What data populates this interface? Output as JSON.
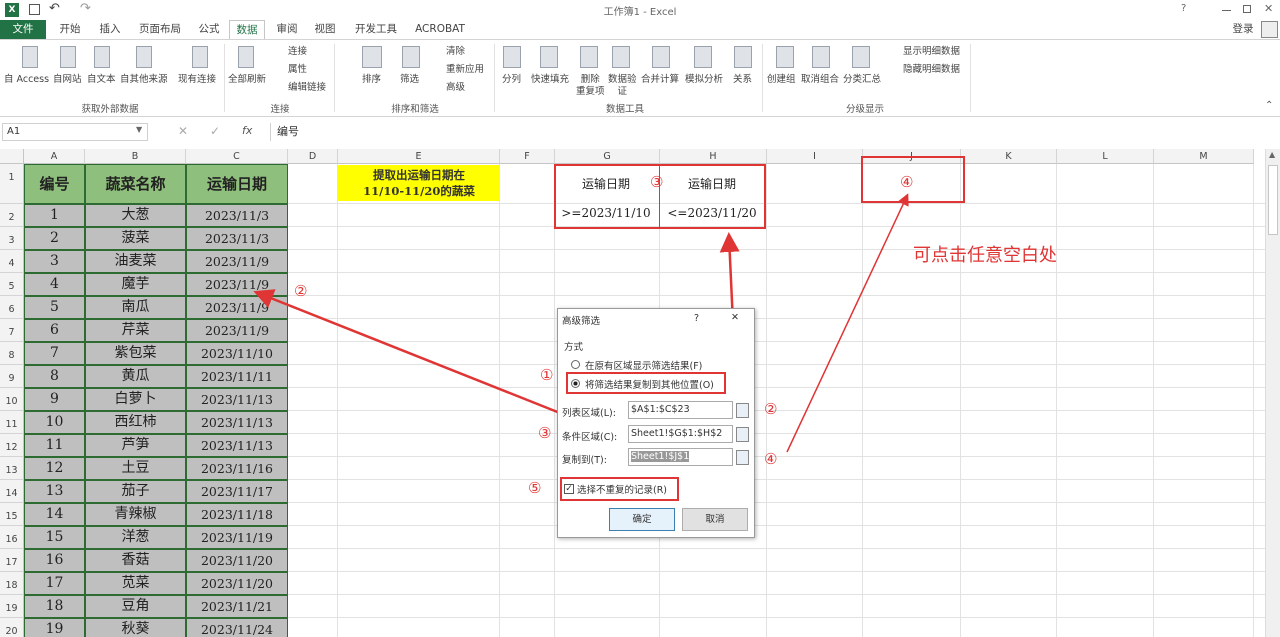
{
  "app": {
    "title": "工作簿1 - Excel",
    "help": "?",
    "login": "登录"
  },
  "tabs": [
    "文件",
    "开始",
    "插入",
    "页面布局",
    "公式",
    "数据",
    "审阅",
    "视图",
    "开发工具",
    "ACROBAT"
  ],
  "ribbon": {
    "get_external": [
      "自 Access",
      "自网站",
      "自文本",
      "自其他来源",
      "现有连接"
    ],
    "get_external_group": "获取外部数据",
    "refresh_all": "全部刷新",
    "conn_items": [
      "连接",
      "属性",
      "编辑链接"
    ],
    "conn_group": "连接",
    "sort": "排序",
    "filter": "筛选",
    "filter_items": [
      "清除",
      "重新应用",
      "高级"
    ],
    "sort_group": "排序和筛选",
    "tools": [
      "分列",
      "快速填充",
      "删除\n重复项",
      "数据验\n证",
      "合并计算",
      "模拟分析",
      "关系"
    ],
    "tools_group": "数据工具",
    "outline": [
      "创建组",
      "取消组合",
      "分类汇总"
    ],
    "outline_right": [
      "显示明细数据",
      "隐藏明细数据"
    ],
    "outline_group": "分级显示"
  },
  "formula": {
    "name_box": "A1",
    "fx": "fx",
    "content": "编号"
  },
  "columns": [
    "A",
    "B",
    "C",
    "D",
    "E",
    "F",
    "G",
    "H",
    "I",
    "J",
    "K",
    "L",
    "M"
  ],
  "rows": [
    "1",
    "2",
    "3",
    "4",
    "5",
    "6",
    "7",
    "8",
    "9",
    "10",
    "11",
    "12",
    "13",
    "14",
    "15",
    "16",
    "17",
    "18",
    "19",
    "20"
  ],
  "table": {
    "headers": [
      "编号",
      "蔬菜名称",
      "运输日期"
    ],
    "data": [
      [
        "1",
        "大葱",
        "2023/11/3"
      ],
      [
        "2",
        "菠菜",
        "2023/11/3"
      ],
      [
        "3",
        "油麦菜",
        "2023/11/9"
      ],
      [
        "4",
        "魔芋",
        "2023/11/9"
      ],
      [
        "5",
        "南瓜",
        "2023/11/9"
      ],
      [
        "6",
        "芹菜",
        "2023/11/9"
      ],
      [
        "7",
        "紫包菜",
        "2023/11/10"
      ],
      [
        "8",
        "黄瓜",
        "2023/11/11"
      ],
      [
        "9",
        "白萝卜",
        "2023/11/13"
      ],
      [
        "10",
        "西红柿",
        "2023/11/13"
      ],
      [
        "11",
        "芦笋",
        "2023/11/13"
      ],
      [
        "12",
        "土豆",
        "2023/11/16"
      ],
      [
        "13",
        "茄子",
        "2023/11/17"
      ],
      [
        "14",
        "青辣椒",
        "2023/11/18"
      ],
      [
        "15",
        "洋葱",
        "2023/11/19"
      ],
      [
        "16",
        "香菇",
        "2023/11/20"
      ],
      [
        "17",
        "苋菜",
        "2023/11/20"
      ],
      [
        "18",
        "豆角",
        "2023/11/21"
      ],
      [
        "19",
        "秋葵",
        "2023/11/24"
      ]
    ]
  },
  "note": {
    "line1": "提取出运输日期在",
    "line2": "11/10-11/20的蔬菜"
  },
  "criteria": {
    "g1": "运输日期",
    "h1": "运输日期",
    "g2": ">=2023/11/10",
    "h2": "<=2023/11/20"
  },
  "annotations": {
    "c1": "①",
    "c2": "②",
    "c3": "③",
    "c4": "④",
    "c5": "⑤",
    "tip": "可点击任意空白处"
  },
  "dialog": {
    "title": "高级筛选",
    "help": "?",
    "close": "✕",
    "method": "方式",
    "opt1": "在原有区域显示筛选结果(F)",
    "opt2": "将筛选结果复制到其他位置(O)",
    "list_label": "列表区域(L):",
    "list_value": "$A$1:$C$23",
    "crit_label": "条件区域(C):",
    "crit_value": "Sheet1!$G$1:$H$2",
    "copy_label": "复制到(T):",
    "copy_value": "Sheet1!$J$1",
    "unique": "选择不重复的记录(R)",
    "ok": "确定",
    "cancel": "取消"
  }
}
